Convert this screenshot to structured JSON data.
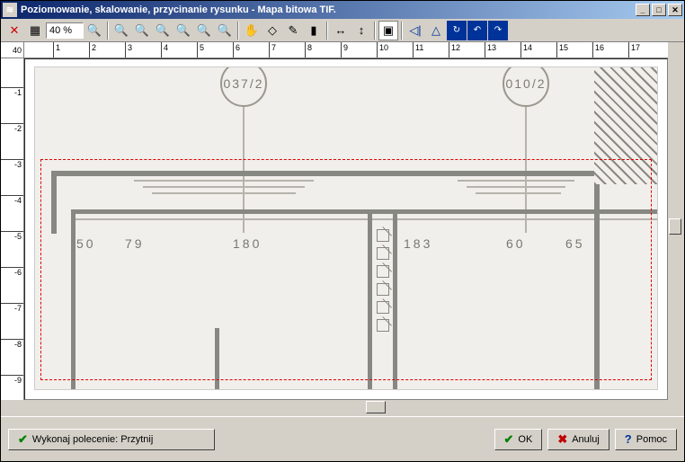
{
  "window": {
    "title": "Poziomowanie, skalowanie, przycinanie rysunku - Mapa bitowa TIF.",
    "icon": "≋"
  },
  "toolbar": {
    "close": "✕",
    "grid": "▦",
    "zoom_value": "40 %",
    "zoom_in": "🔍",
    "zoom_fit": "⊡",
    "crop": "⬚",
    "flip_h": "◁",
    "flip_v": "▷",
    "rot_l": "↺",
    "rot_r": "↻",
    "undo": "↶",
    "redo": "↷"
  },
  "rulers": {
    "corner": "40",
    "h_ticks": [
      "1",
      "2",
      "3",
      "4",
      "5",
      "6",
      "7",
      "8",
      "9",
      "10",
      "11",
      "12",
      "13",
      "14",
      "15",
      "16",
      "17"
    ],
    "v_ticks": [
      "-1",
      "-2",
      "-3",
      "-4",
      "-5",
      "-6",
      "-7",
      "-8",
      "-9"
    ]
  },
  "drawing": {
    "label_left": "037/2",
    "label_right": "010/2",
    "dims": {
      "d50": "50",
      "d79": "79",
      "d180": "180",
      "d183": "183",
      "d60": "60",
      "d65": "65"
    }
  },
  "buttons": {
    "execute": "Wykonaj polecenie: Przytnij",
    "ok": "OK",
    "cancel": "Anuluj",
    "help": "Pomoc"
  }
}
